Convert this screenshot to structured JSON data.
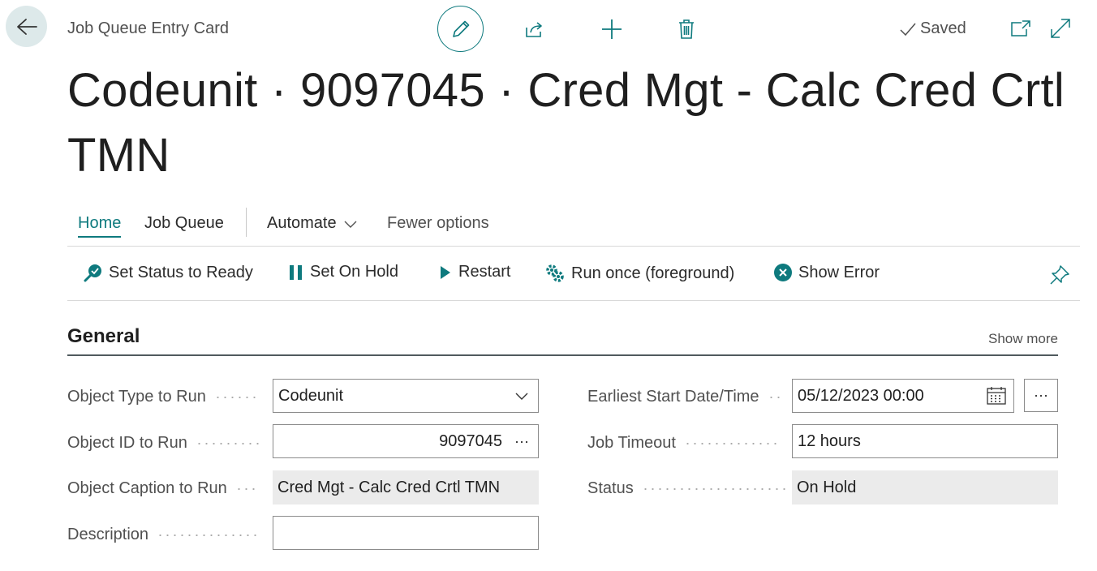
{
  "header": {
    "caption": "Job Queue Entry Card",
    "saved_label": "Saved",
    "title": "Codeunit · 9097045 · Cred Mgt - Calc Cred Crtl TMN"
  },
  "tabs": {
    "home": "Home",
    "job_queue": "Job Queue",
    "automate": "Automate",
    "fewer_options": "Fewer options"
  },
  "actions": {
    "set_ready": "Set Status to Ready",
    "set_on_hold": "Set On Hold",
    "restart": "Restart",
    "run_once": "Run once (foreground)",
    "show_error": "Show Error"
  },
  "general": {
    "title": "General",
    "show_more": "Show more",
    "fields": {
      "object_type": {
        "label": "Object Type to Run",
        "value": "Codeunit"
      },
      "object_id": {
        "label": "Object ID to Run",
        "value": "9097045"
      },
      "object_caption": {
        "label": "Object Caption to Run",
        "value": "Cred Mgt - Calc Cred Crtl TMN"
      },
      "description": {
        "label": "Description",
        "value": ""
      },
      "earliest_start": {
        "label": "Earliest Start Date/Time",
        "value": "05/12/2023 00:00"
      },
      "job_timeout": {
        "label": "Job Timeout",
        "value": "12 hours"
      },
      "status": {
        "label": "Status",
        "value": "On Hold"
      }
    },
    "ellipsis": "···"
  },
  "colors": {
    "accent": "#0e7a7e",
    "back_bg": "#dde9ea",
    "readonly_bg": "#ebebeb"
  }
}
